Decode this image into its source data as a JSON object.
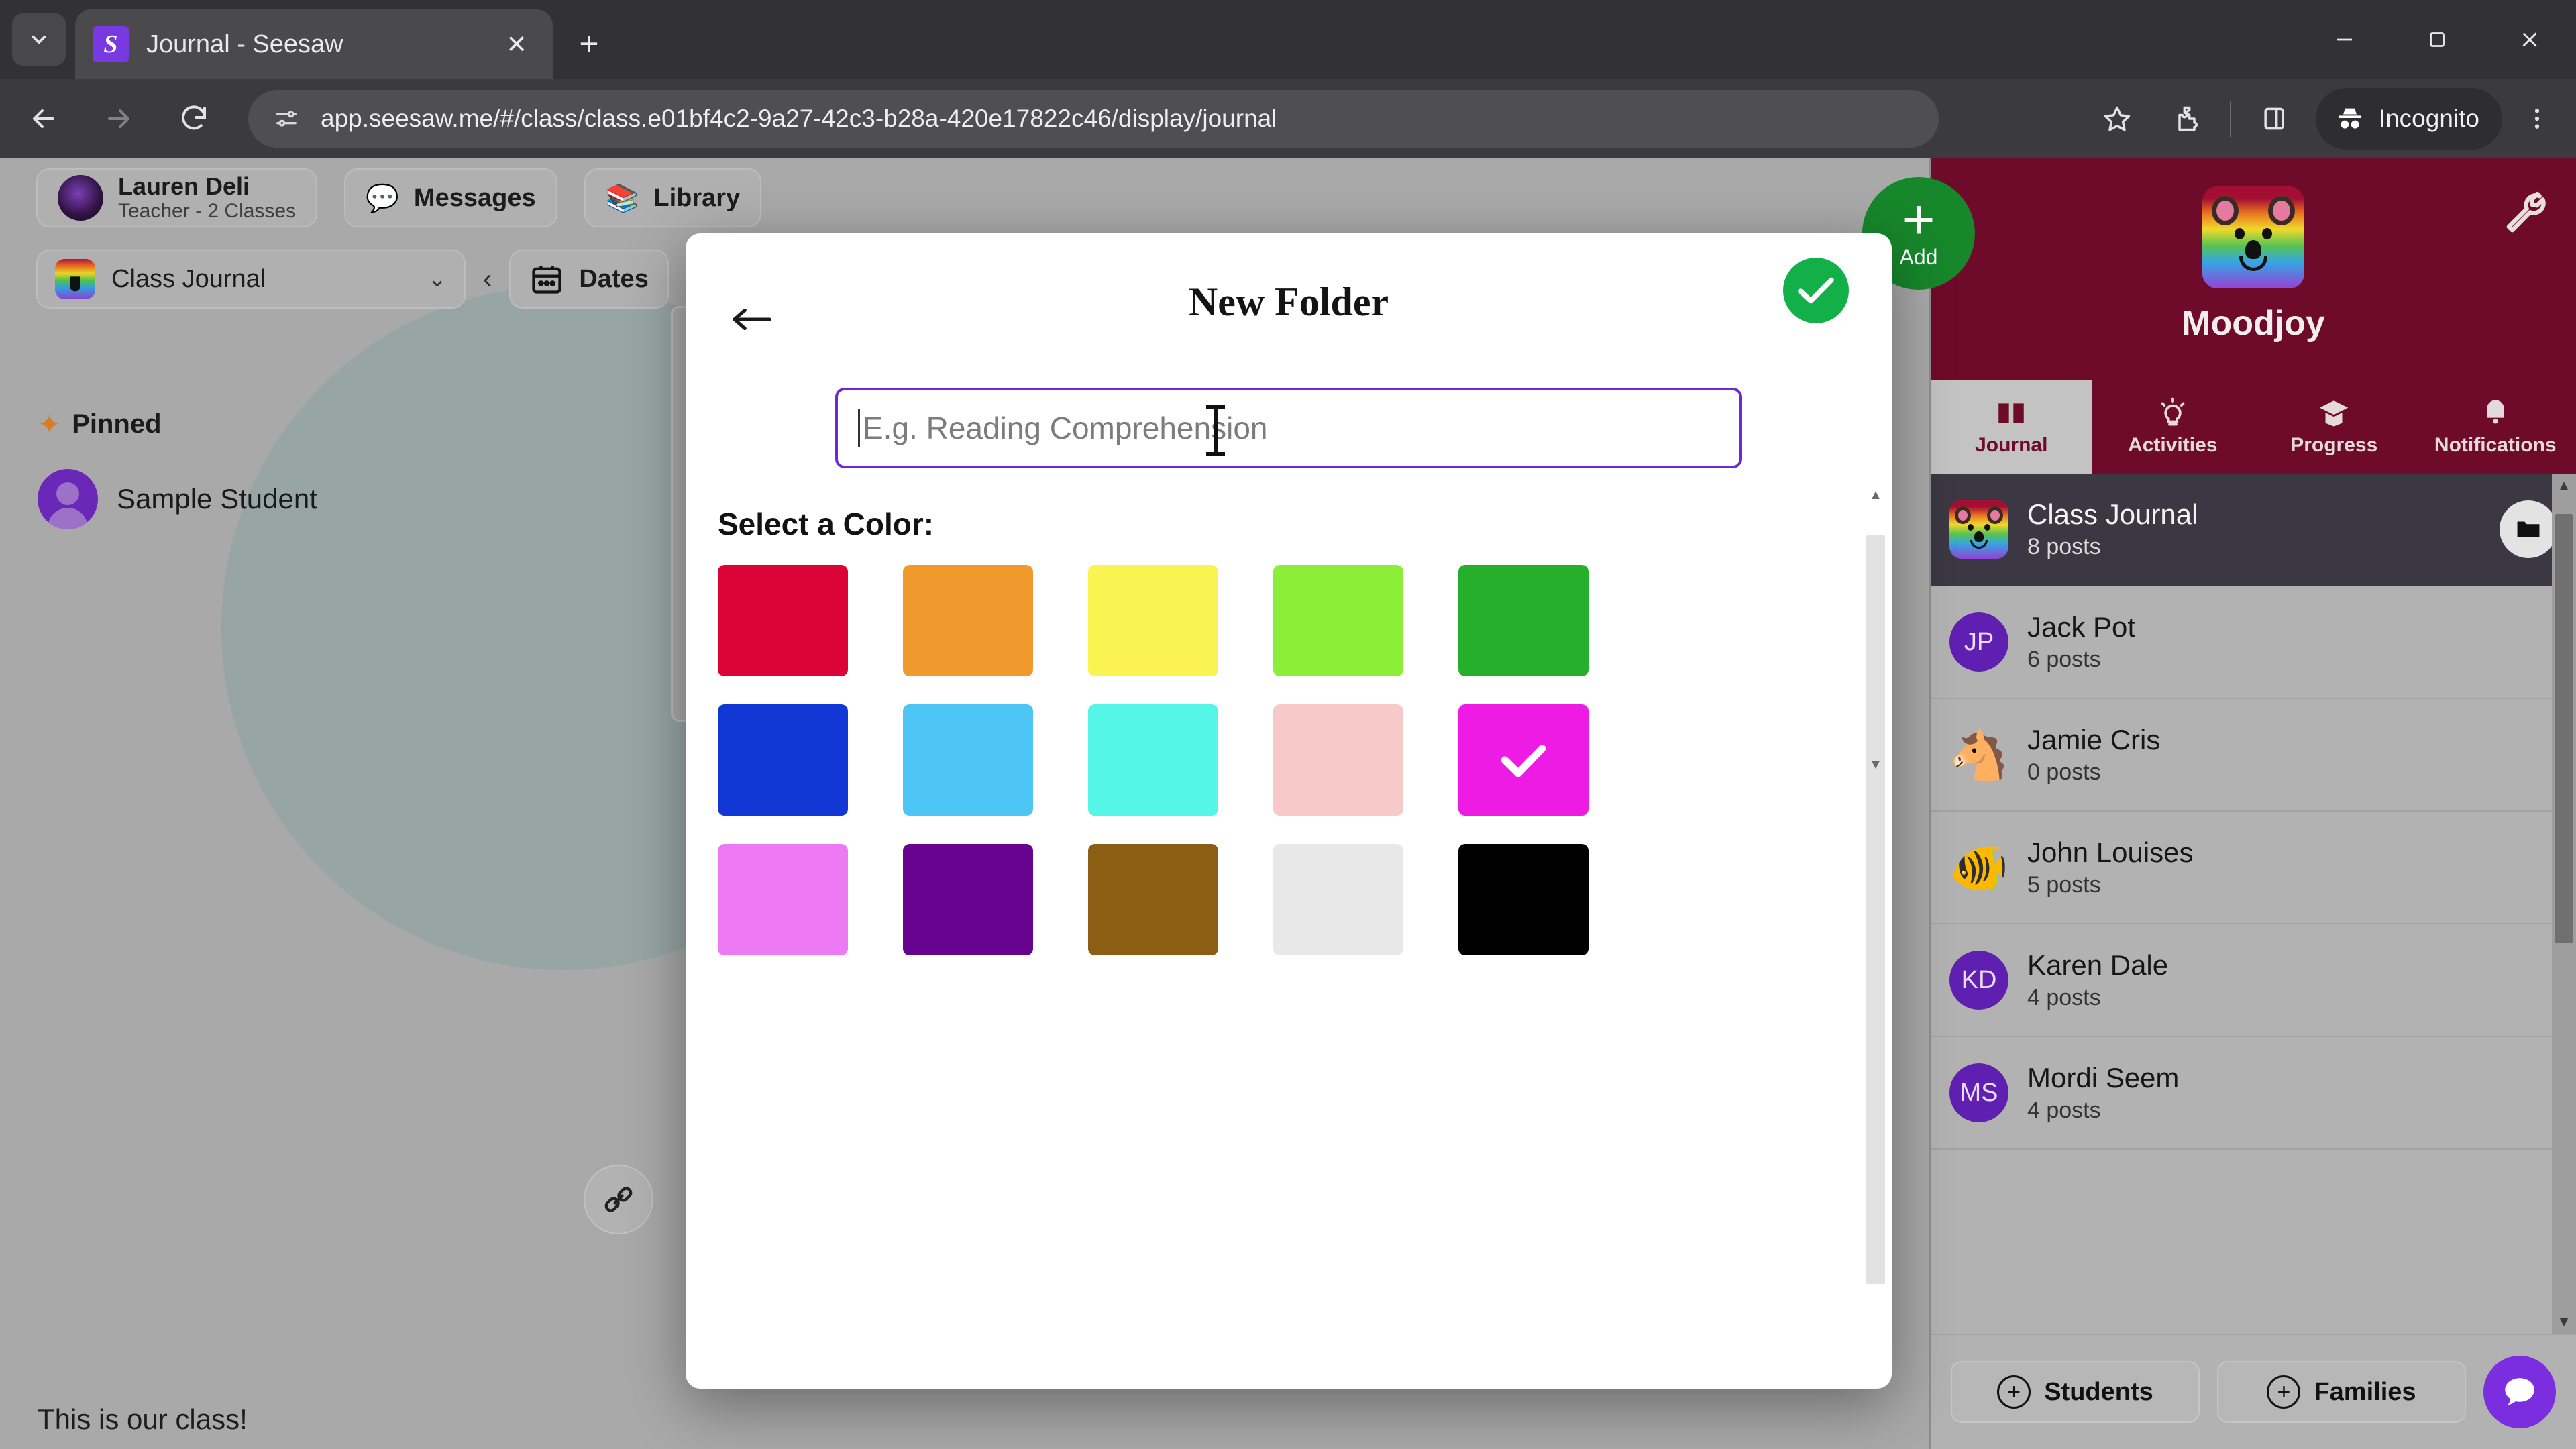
{
  "browser": {
    "tab": {
      "title": "Journal - Seesaw",
      "favicon_icon": "seesaw-logo-icon",
      "close_icon": "close-icon"
    },
    "tabstrip": {
      "chevron_icon": "chevron-down-icon",
      "new_tab_icon": "plus-icon"
    },
    "window_controls": {
      "minimize_icon": "minimize-icon",
      "maximize_icon": "maximize-icon",
      "close_icon": "close-icon"
    },
    "toolbar": {
      "back_icon": "arrow-left-icon",
      "forward_icon": "arrow-right-icon",
      "reload_icon": "reload-icon",
      "site_info_icon": "tune-settings-icon",
      "url": "app.seesaw.me/#/class/class.e01bf4c2-9a27-42c3-b28a-420e17822c46/display/journal",
      "bookmark_icon": "star-icon",
      "extensions_icon": "extensions-puzzle-icon",
      "side_panel_icon": "side-panel-icon",
      "incognito_label": "Incognito",
      "incognito_icon": "incognito-hat-icon",
      "menu_icon": "three-dot-menu-icon"
    }
  },
  "app": {
    "teacher": {
      "name": "Lauren Deli",
      "role": "Teacher - 2 Classes",
      "avatar_icon": "teacher-avatar"
    },
    "messages_label": "Messages",
    "messages_icon": "speech-bubbles-icon",
    "library_label": "Library",
    "library_icon": "books-icon",
    "class_selector": {
      "value": "Class Journal",
      "caret_icon": "chevron-down-icon",
      "badge_icon": "rainbow-bear-icon"
    },
    "prev_icon": "chevron-left-icon",
    "dates_label": "Dates",
    "dates_icon": "calendar-icon",
    "pinned": {
      "label": "Pinned",
      "icon": "pin-star-icon",
      "student": "Sample Student"
    },
    "link_icon": "link-chain-icon",
    "class_caption": "This is our class!"
  },
  "sidebar": {
    "add_button": {
      "label": "Add",
      "icon": "plus-icon"
    },
    "settings_icon": "wrench-icon",
    "class_name": "Moodjoy",
    "class_avatar_icon": "rainbow-bear-icon",
    "tabs": [
      {
        "label": "Journal",
        "icon": "open-book-icon",
        "active": true
      },
      {
        "label": "Activities",
        "icon": "lightbulb-icon",
        "active": false
      },
      {
        "label": "Progress",
        "icon": "graduation-cap-icon",
        "active": false
      },
      {
        "label": "Notifications",
        "icon": "bell-icon",
        "active": false
      }
    ],
    "rows": [
      {
        "name": "Class Journal",
        "posts": "8 posts",
        "avatar_type": "class-badge",
        "initials": "",
        "emoji": "",
        "selected": true,
        "folder_icon": "folder-icon"
      },
      {
        "name": "Jack Pot",
        "posts": "6 posts",
        "avatar_type": "initials",
        "initials": "JP",
        "emoji": "",
        "selected": false,
        "folder_icon": ""
      },
      {
        "name": "Jamie Cris",
        "posts": "0 posts",
        "avatar_type": "emoji",
        "initials": "",
        "emoji": "🐴",
        "selected": false,
        "folder_icon": ""
      },
      {
        "name": "John Louises",
        "posts": "5 posts",
        "avatar_type": "emoji",
        "initials": "",
        "emoji": "🐠",
        "selected": false,
        "folder_icon": ""
      },
      {
        "name": "Karen Dale",
        "posts": "4 posts",
        "avatar_type": "initials",
        "initials": "KD",
        "emoji": "",
        "selected": false,
        "folder_icon": ""
      },
      {
        "name": "Mordi Seem",
        "posts": "4 posts",
        "avatar_type": "initials",
        "initials": "MS",
        "emoji": "",
        "selected": false,
        "folder_icon": ""
      }
    ],
    "footer": {
      "students_label": "Students",
      "families_label": "Families",
      "plus_glyph": "+",
      "chat_icon": "chat-bubble-icon"
    },
    "scroll_up_icon": "triangle-up-icon",
    "scroll_down_icon": "triangle-down-icon"
  },
  "modal": {
    "title": "New Folder",
    "back_icon": "arrow-left-icon",
    "done_icon": "check-icon",
    "done_color": "#13b04a",
    "name_input": {
      "value": "",
      "placeholder": "E.g. Reading Comprehension",
      "focus_border_color": "#6d29d9"
    },
    "color_label": "Select a Color:",
    "selected_color_index": 9,
    "selected_check_icon": "check-icon",
    "colors": [
      {
        "name": "red",
        "hex": "#DC0436"
      },
      {
        "name": "orange",
        "hex": "#F09A2E"
      },
      {
        "name": "yellow",
        "hex": "#FBF351"
      },
      {
        "name": "lime",
        "hex": "#8CEE39"
      },
      {
        "name": "green",
        "hex": "#25AF2B"
      },
      {
        "name": "blue",
        "hex": "#1138D4"
      },
      {
        "name": "light-blue",
        "hex": "#4DC5F5"
      },
      {
        "name": "cyan",
        "hex": "#55F5E8"
      },
      {
        "name": "pink",
        "hex": "#F7C9C8"
      },
      {
        "name": "magenta",
        "hex": "#EE1BE5"
      },
      {
        "name": "violet",
        "hex": "#EE79F5"
      },
      {
        "name": "purple",
        "hex": "#680291"
      },
      {
        "name": "brown",
        "hex": "#8C5E13"
      },
      {
        "name": "light-gray",
        "hex": "#E8E8E8"
      },
      {
        "name": "black",
        "hex": "#000000"
      }
    ],
    "scroll_up_icon": "triangle-up-icon",
    "scroll_down_icon": "triangle-down-icon"
  }
}
